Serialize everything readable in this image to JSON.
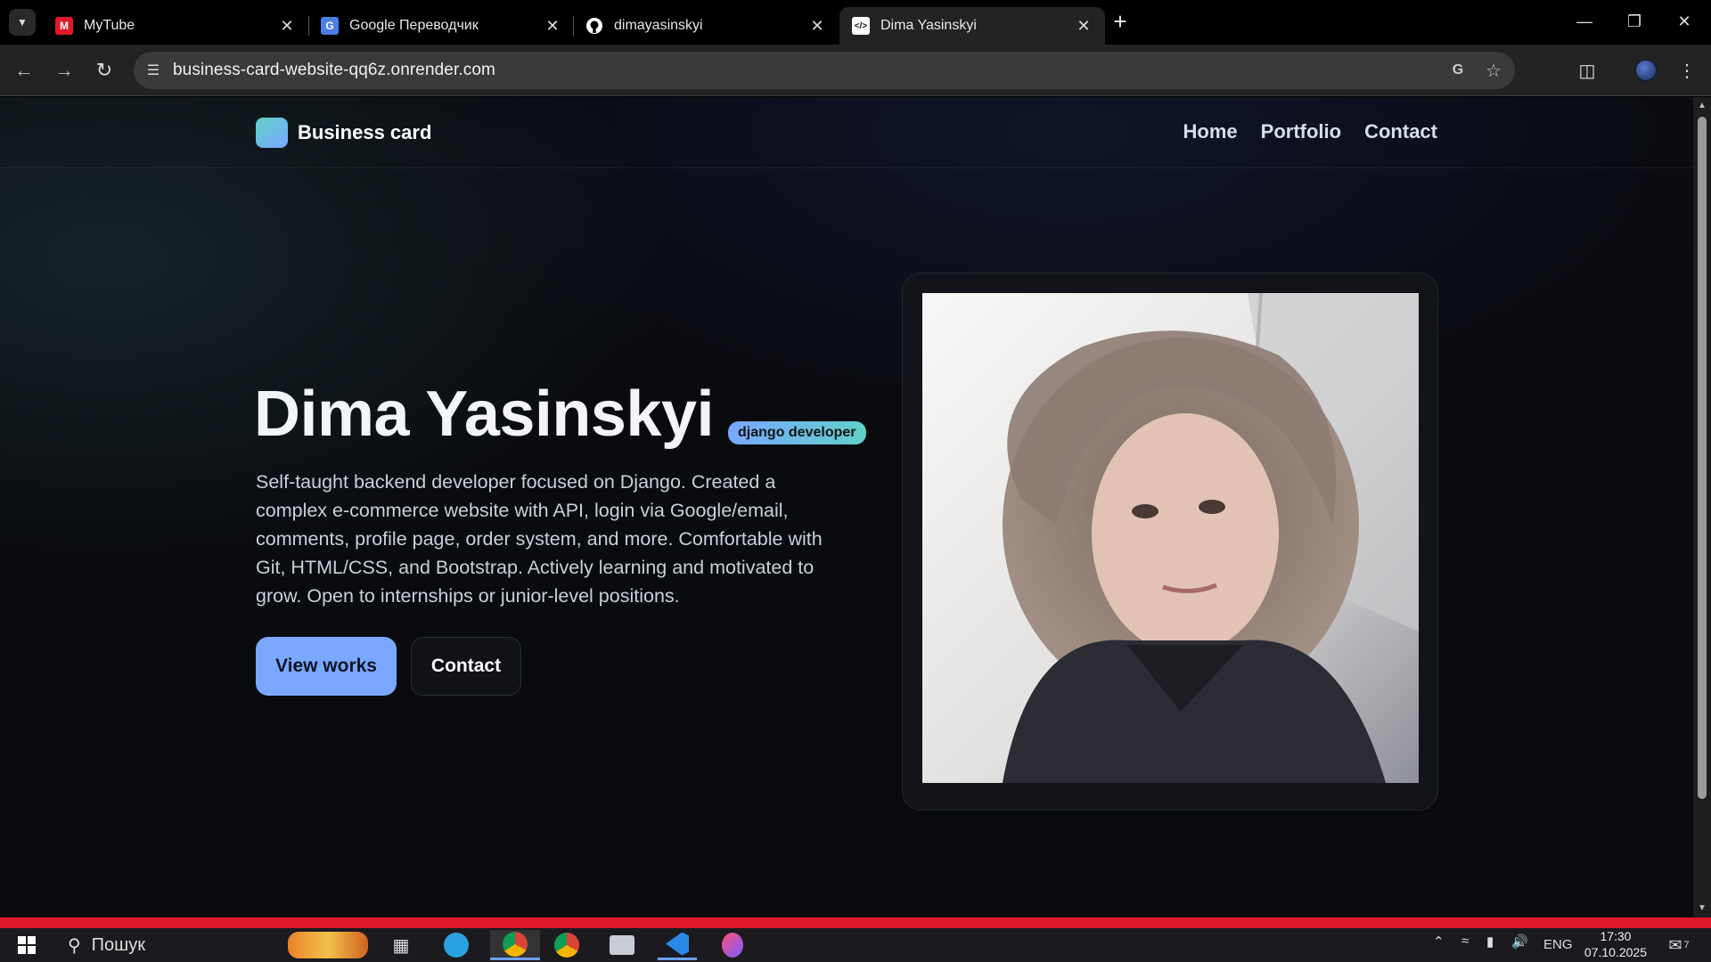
{
  "browser": {
    "tabs": [
      {
        "title": "MyTube",
        "favicon": "M",
        "active": false
      },
      {
        "title": "Google Переводчик",
        "favicon": "G",
        "active": false
      },
      {
        "title": "dimayasinskyi",
        "favicon": "github-icon",
        "active": false
      },
      {
        "title": "Dima Yasinskyi",
        "favicon": "</>",
        "active": true
      }
    ],
    "url": "business-card-website-qq6z.onrender.com"
  },
  "site": {
    "brand": "Business card",
    "nav": [
      "Home",
      "Portfolio",
      "Contact"
    ],
    "hero": {
      "name": "Dima Yasinskyi",
      "badge": "django developer",
      "description": "Self-taught backend developer focused on Django. Created a complex e-commerce website with API, login via Google/email, comments, profile page, order system, and more. Comfortable with Git, HTML/CSS, and Bootstrap. Actively learning and motivated to grow. Open to internships or junior-level positions.",
      "primary_button": "View works",
      "secondary_button": "Contact"
    }
  },
  "taskbar": {
    "search_placeholder": "Пошук",
    "language": "ENG",
    "time": "17:30",
    "date": "07.10.2025",
    "notifications": "7"
  },
  "colors": {
    "accent": "#7aa7ff",
    "accent2": "#5fd1c7",
    "taskbar_accent": "#e0182b"
  }
}
